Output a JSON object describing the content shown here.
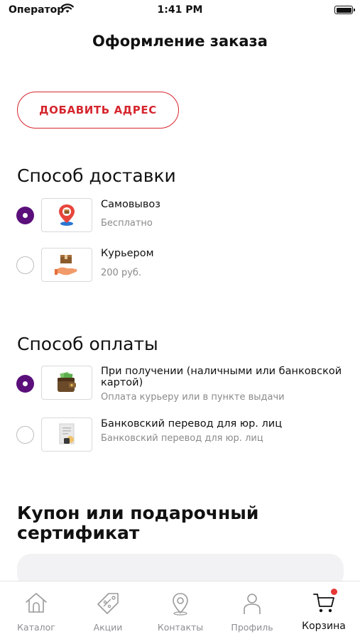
{
  "status_bar": {
    "carrier": "Оператор",
    "time": "1:41 PM"
  },
  "header": {
    "title": "Оформление заказа"
  },
  "address": {
    "add_label": "ДОБАВИТЬ АДРЕС"
  },
  "delivery": {
    "heading": "Способ доставки",
    "options": [
      {
        "title": "Самовывоз",
        "subtitle": "Бесплатно",
        "selected": true,
        "icon": "pickup-location-icon"
      },
      {
        "title": "Курьером",
        "subtitle": "200 руб.",
        "selected": false,
        "icon": "courier-box-icon"
      }
    ]
  },
  "payment": {
    "heading": "Способ оплаты",
    "options": [
      {
        "title": "При получении (наличными или банковской картой)",
        "subtitle": "Оплата курьеру или в пункте выдачи",
        "selected": true,
        "icon": "wallet-icon"
      },
      {
        "title": "Банковский перевод для юр. лиц",
        "subtitle": "Банковский перевод для юр. лиц",
        "selected": false,
        "icon": "bank-document-icon"
      }
    ]
  },
  "coupon": {
    "heading": "Купон или подарочный сертификат",
    "value": ""
  },
  "tabs": [
    {
      "label": "Каталог",
      "icon": "home-icon",
      "active": false
    },
    {
      "label": "Акции",
      "icon": "tag-icon",
      "active": false
    },
    {
      "label": "Контакты",
      "icon": "location-pin-icon",
      "active": false
    },
    {
      "label": "Профиль",
      "icon": "user-icon",
      "active": false
    },
    {
      "label": "Корзина",
      "icon": "cart-icon",
      "active": true
    }
  ],
  "colors": {
    "accent": "#d6262e",
    "radio_selected": "#5a0f7a",
    "badge": "#e53935"
  }
}
